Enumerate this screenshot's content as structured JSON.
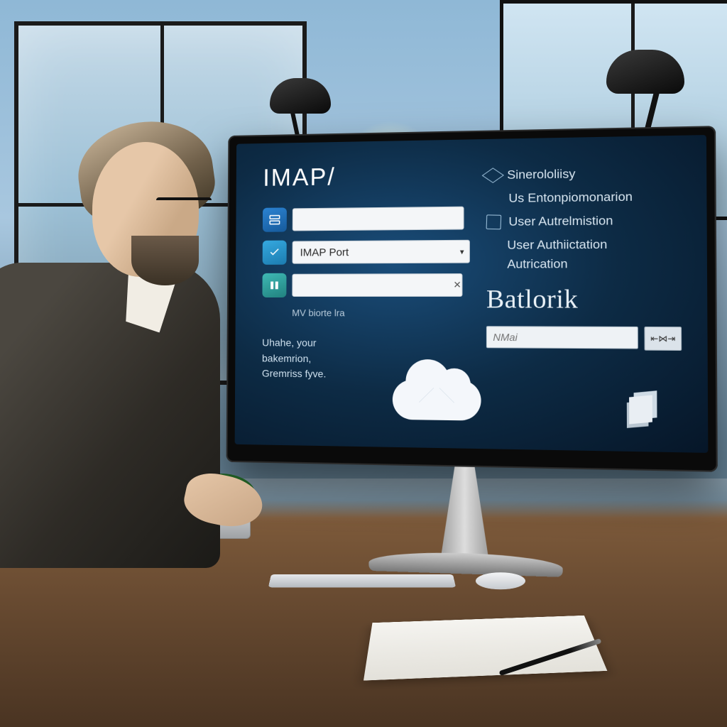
{
  "screen": {
    "title": "IMAP/",
    "fields": {
      "server": {
        "value": "",
        "placeholder": ""
      },
      "port": {
        "value": "IMAP Port",
        "placeholder": "IMAP Port"
      },
      "third": {
        "value": "",
        "placeholder": ""
      }
    },
    "sublabel": "MV biorte lra",
    "helper_line1": "Uhahe, your",
    "helper_line2": "bakemrion,",
    "helper_line3": "Gremriss fyve.",
    "cloud_icon": "cloud-mail-icon"
  },
  "side": {
    "items": [
      {
        "icon": "cube",
        "label": "Sinerololiisy"
      },
      {
        "icon": "none",
        "label": "Us Entonpiomonarion"
      },
      {
        "icon": "square",
        "label": "User Autrelmistion"
      }
    ],
    "sub1": "User Authiictation",
    "sub2": "Autrication",
    "brand": "Batlorik",
    "mini_input": {
      "value": "",
      "placeholder": "NMai"
    },
    "mini_button": "⇤⋈⇥",
    "paper_icon": "papers-icon"
  }
}
